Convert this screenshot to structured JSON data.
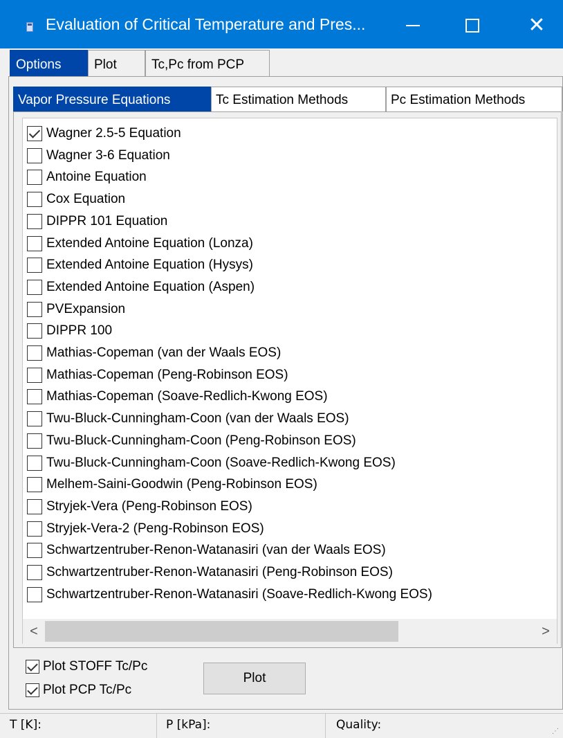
{
  "window": {
    "title": "Evaluation of Critical Temperature and Pres...",
    "accent_color": "#0078d7",
    "icons": [
      "app-icon",
      "minimize-icon",
      "maximize-icon",
      "close-icon"
    ],
    "close_glyph": "✕"
  },
  "tabs": [
    {
      "label": "Options",
      "active": true
    },
    {
      "label": "Plot",
      "active": false
    },
    {
      "label": "Tc,Pc from PCP",
      "active": false
    }
  ],
  "inner_tabs": [
    {
      "label": "Vapor Pressure Equations",
      "active": true
    },
    {
      "label": "Tc Estimation Methods",
      "active": false
    },
    {
      "label": "Pc Estimation Methods",
      "active": false
    }
  ],
  "equations": [
    {
      "label": "Wagner 2.5-5 Equation",
      "checked": true
    },
    {
      "label": "Wagner 3-6 Equation",
      "checked": false
    },
    {
      "label": "Antoine Equation",
      "checked": false
    },
    {
      "label": "Cox Equation",
      "checked": false
    },
    {
      "label": "DIPPR 101 Equation",
      "checked": false
    },
    {
      "label": "Extended Antoine Equation (Lonza)",
      "checked": false
    },
    {
      "label": "Extended Antoine Equation (Hysys)",
      "checked": false
    },
    {
      "label": "Extended Antoine Equation (Aspen)",
      "checked": false
    },
    {
      "label": "PVExpansion",
      "checked": false
    },
    {
      "label": "DIPPR 100",
      "checked": false
    },
    {
      "label": "Mathias-Copeman (van der Waals EOS)",
      "checked": false
    },
    {
      "label": "Mathias-Copeman (Peng-Robinson EOS)",
      "checked": false
    },
    {
      "label": "Mathias-Copeman (Soave-Redlich-Kwong EOS)",
      "checked": false
    },
    {
      "label": "Twu-Bluck-Cunningham-Coon (van der Waals EOS)",
      "checked": false
    },
    {
      "label": "Twu-Bluck-Cunningham-Coon (Peng-Robinson EOS)",
      "checked": false
    },
    {
      "label": "Twu-Bluck-Cunningham-Coon (Soave-Redlich-Kwong EOS)",
      "checked": false
    },
    {
      "label": "Melhem-Saini-Goodwin (Peng-Robinson EOS)",
      "checked": false
    },
    {
      "label": "Stryjek-Vera (Peng-Robinson EOS)",
      "checked": false
    },
    {
      "label": "Stryjek-Vera-2 (Peng-Robinson EOS)",
      "checked": false
    },
    {
      "label": "Schwartzentruber-Renon-Watanasiri (van der Waals EOS)",
      "checked": false
    },
    {
      "label": "Schwartzentruber-Renon-Watanasiri (Peng-Robinson EOS)",
      "checked": false
    },
    {
      "label": "Schwartzentruber-Renon-Watanasiri (Soave-Redlich-Kwong EOS)",
      "checked": false
    }
  ],
  "scrollbar": {
    "left_arrow": "<",
    "right_arrow": ">"
  },
  "options": {
    "plot_stoff": {
      "label": "Plot STOFF Tc/Pc",
      "checked": true
    },
    "plot_pcp": {
      "label": "Plot PCP Tc/Pc",
      "checked": true
    },
    "plot_button": "Plot"
  },
  "status": {
    "t_label": "T [K]:",
    "p_label": "P [kPa]:",
    "quality_label": "Quality:"
  }
}
